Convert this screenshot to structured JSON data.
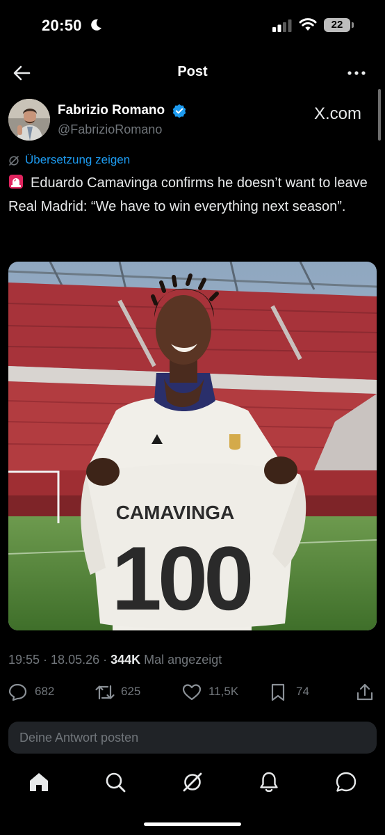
{
  "status": {
    "time": "20:50",
    "battery": "22"
  },
  "header": {
    "title": "Post"
  },
  "author": {
    "name": "Fabrizio Romano",
    "handle": "@FabrizioRomano",
    "source_label": "X.com"
  },
  "post": {
    "translate_label": "Übersetzung zeigen",
    "text": "Eduardo Camavinga confirms he doesn’t want to leave Real Madrid: “We have to win everything next season”.",
    "media": {
      "shirt_name": "CAMAVINGA",
      "shirt_number": "100"
    },
    "timestamp": "19:55 · 18.05.26 · ",
    "views": "344K",
    "views_label": "Mal angezeigt"
  },
  "stats": {
    "replies": "682",
    "reposts": "625",
    "likes": "11,5K",
    "bookmarks": "74"
  },
  "reply": {
    "placeholder": "Deine Antwort posten"
  },
  "icons": [
    "moon-icon",
    "signal-icon",
    "wifi-icon",
    "back-arrow-icon",
    "more-icon",
    "verified-badge-icon",
    "grok-icon",
    "siren-icon",
    "reply-icon",
    "repost-icon",
    "like-icon",
    "bookmark-icon",
    "share-icon",
    "home-icon",
    "search-icon",
    "notifications-icon",
    "messages-icon"
  ],
  "colors": {
    "background": "#000000",
    "accent": "#1d9bf0",
    "text_primary": "#e7e9ea",
    "text_secondary": "#71767b"
  }
}
